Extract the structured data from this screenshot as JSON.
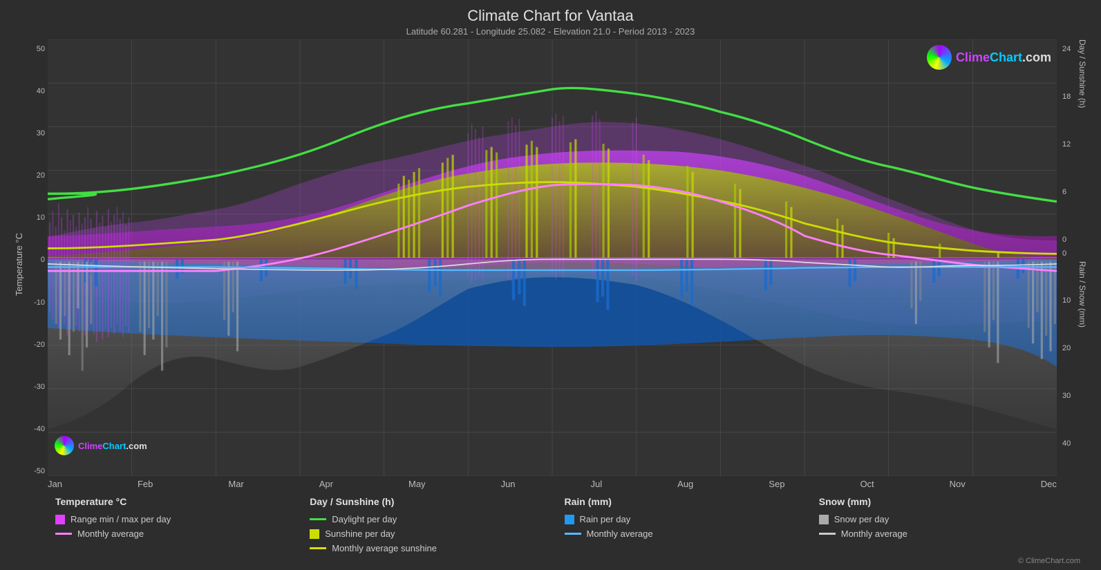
{
  "title": "Climate Chart for Vantaa",
  "subtitle": "Latitude 60.281 - Longitude 25.082 - Elevation 21.0 - Period 2013 - 2023",
  "copyright": "© ClimeChart.com",
  "yaxis_left_label": "Temperature °C",
  "yaxis_right_top_label": "Day / Sunshine (h)",
  "yaxis_right_bottom_label": "Rain / Snow (mm)",
  "y_ticks_left": [
    "50",
    "40",
    "30",
    "20",
    "10",
    "0",
    "-10",
    "-20",
    "-30",
    "-40",
    "-50"
  ],
  "y_ticks_right_top": [
    "24",
    "18",
    "12",
    "6",
    "0"
  ],
  "y_ticks_right_bottom": [
    "0",
    "10",
    "20",
    "30",
    "40"
  ],
  "x_months": [
    "Jan",
    "Feb",
    "Mar",
    "Apr",
    "May",
    "Jun",
    "Jul",
    "Aug",
    "Sep",
    "Oct",
    "Nov",
    "Dec"
  ],
  "legend": {
    "col1_title": "Temperature °C",
    "col1_items": [
      {
        "type": "box",
        "color": "#e040fb",
        "label": "Range min / max per day"
      },
      {
        "type": "line",
        "color": "#ff80ff",
        "label": "Monthly average"
      }
    ],
    "col2_title": "Day / Sunshine (h)",
    "col2_items": [
      {
        "type": "line",
        "color": "#44dd44",
        "label": "Daylight per day"
      },
      {
        "type": "box",
        "color": "#ccdd00",
        "label": "Sunshine per day"
      },
      {
        "type": "line",
        "color": "#dddd00",
        "label": "Monthly average sunshine"
      }
    ],
    "col3_title": "Rain (mm)",
    "col3_items": [
      {
        "type": "box",
        "color": "#2299ee",
        "label": "Rain per day"
      },
      {
        "type": "line",
        "color": "#55bbff",
        "label": "Monthly average"
      }
    ],
    "col4_title": "Snow (mm)",
    "col4_items": [
      {
        "type": "box",
        "color": "#aaaaaa",
        "label": "Snow per day"
      },
      {
        "type": "line",
        "color": "#cccccc",
        "label": "Monthly average"
      }
    ]
  }
}
